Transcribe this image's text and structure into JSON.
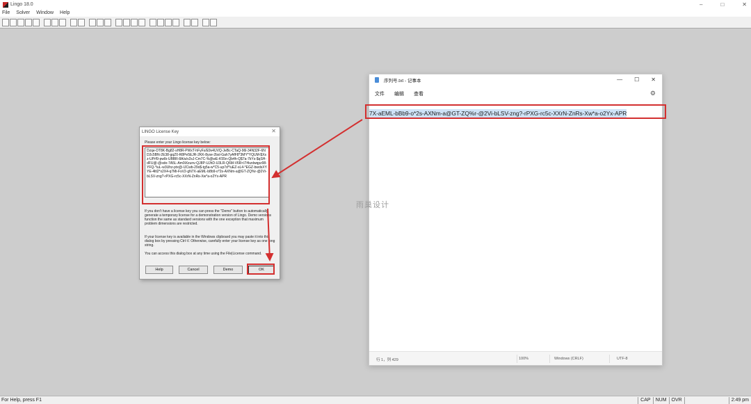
{
  "app": {
    "title": "Lingo 18.0",
    "window_controls": [
      "–",
      "□",
      "✕"
    ]
  },
  "menu": [
    "File",
    "Solver",
    "Window",
    "Help"
  ],
  "toolbar": {
    "button_count": 25
  },
  "status": {
    "help": "For Help, press F1",
    "cap": "CAP",
    "num": "NUM",
    "ovr": "OVR",
    "time": "2:49 pm"
  },
  "license_dialog": {
    "title": "LINGO License Key",
    "close_glyph": "✕",
    "prompt": "Please enter your Lingo license key below:",
    "key_text": "Dzqe-DT8K-Bg82-sH8R-PWxT-hFyFs/E9v4UVQ-JeBc-CTaQ-96l-34N32F-6ND2c5BN-2E38-gqZ0-R8Pe5EJR-2KK-8yse-2bsl-Gah7yAfF8*3MY*YQUM-$Xsz-UPrf9-pwIb-UBBR-8A/a/v2sJ-Cm7C-%@wE-K55n-Qb4h-Q$7a-7kYs-$qSH-dFU@-@sdo-7A5L-Am0iXzunv-QJ8P-UJhD-U3LR-Q6M-V6R<I7#kzdwqpz98-YFQ-*iuL-w3Uhz-ptx@-IJCwb-29s$-tg5a-w*C5-up7d*!uEZ-sL4-*EGZ-bwdsXYYE-4ltl2*x2X4-q7Mi-FsV2-gN7X-aEML-b8b9-o*2s-AXNm-a@GT-ZQ%r-@2Vi-bLSV-zng?-rPXG-rc5c-XXrN-ZnRs-Xw*a-o2Yx-APR",
    "para1": "If you don't have a license key you can press the \"Demo\" button to automatically generate a temporary license for a demonstration version of Lingo. Demo versions function the same as standard versions with the one exception that maximum problem dimensions are restricted.",
    "para2": "If your license key is available in the Windows clipboard you may paste it into this dialog box by pressing Ctrl-V. Otherwise, carefully enter your license key as one long string.",
    "para3": "You can access this dialog box at any time using the File|License command.",
    "buttons": {
      "help": "Help",
      "cancel": "Cancel",
      "demo": "Demo",
      "ok": "OK"
    }
  },
  "notepad": {
    "title": "序列号.txt - 记事本",
    "menu": [
      "文件",
      "编辑",
      "查看"
    ],
    "window_controls": [
      "—",
      "☐",
      "✕"
    ],
    "gear_glyph": "⚙",
    "content": "7X-aEML-bBb9-o*2s-AXNm-a@GT-ZQ%r-@2Vi-bLSV-zng?-rPXG-rc5c-XXrN-ZnRs-Xw*a-o2Yx-APR",
    "status": {
      "position": "行 1，列 429",
      "zoom": "100%",
      "line_ending": "Windows (CRLF)",
      "encoding": "UTF-8"
    }
  },
  "watermark": "雨巢设计",
  "colors": {
    "highlight": "#d32f2f",
    "selection": "#cfe3f7",
    "workspace": "#cdcdcd"
  }
}
